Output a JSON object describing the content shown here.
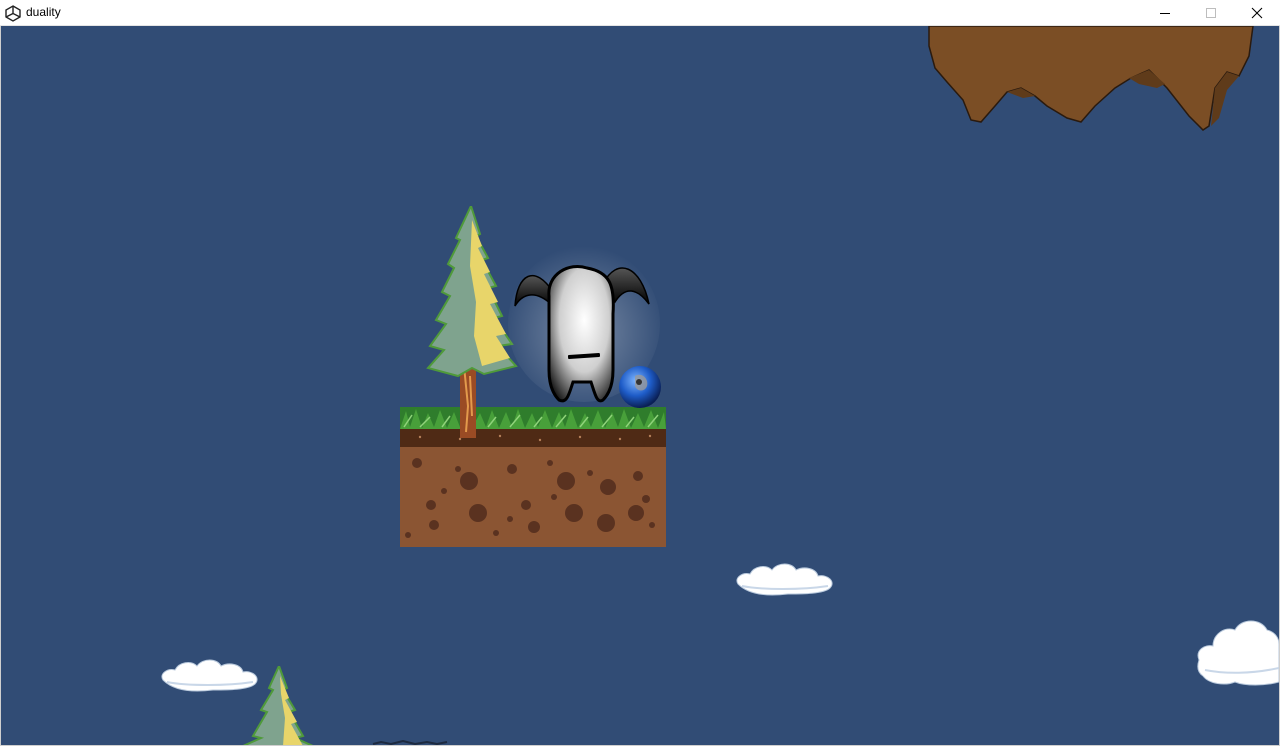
{
  "window": {
    "title": "duality",
    "icon": "unity-icon",
    "controls": [
      "minimize-icon",
      "maximize-icon",
      "close-icon"
    ]
  },
  "scene": {
    "background_color": "#314c75",
    "sprites": [
      "floating-rock-island",
      "grass-dirt-platform",
      "pine-tree",
      "shadow-creature-character",
      "blue-orb",
      "cloud",
      "cloud",
      "cloud",
      "pine-tree"
    ]
  }
}
